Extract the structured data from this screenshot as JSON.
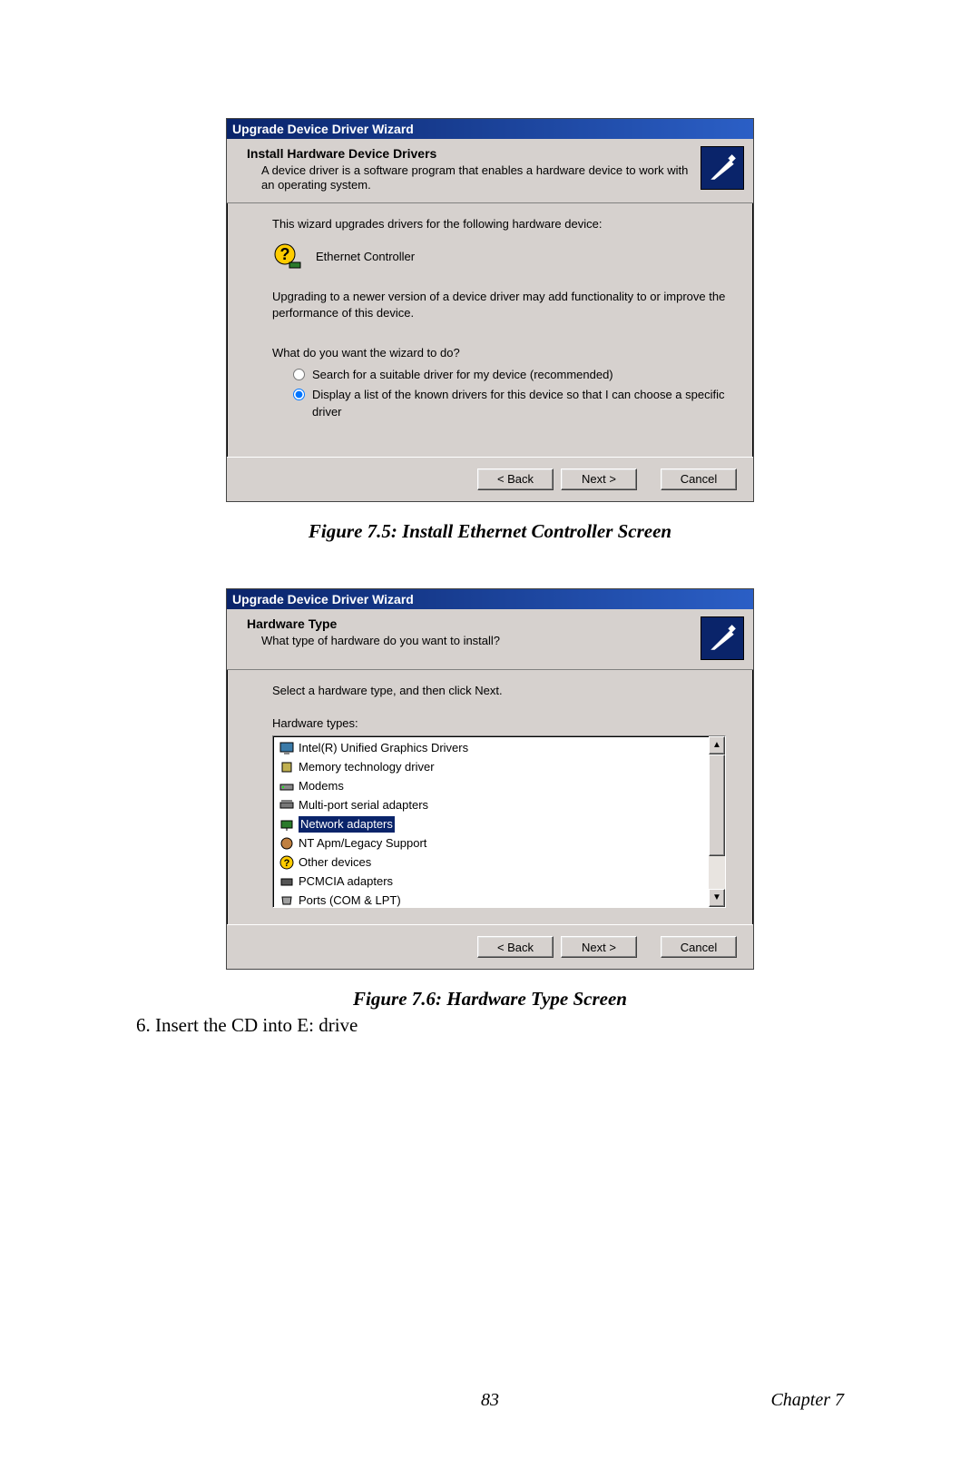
{
  "dialog1": {
    "title": "Upgrade Device Driver Wizard",
    "header_title": "Install Hardware Device Drivers",
    "header_sub": "A device driver is a software program that enables a hardware device to work with an operating system.",
    "intro": "This wizard upgrades drivers for the following hardware device:",
    "device": "Ethernet Controller",
    "upgrade_text": "Upgrading to a newer version of a device driver may add functionality to or improve the performance of this device.",
    "prompt": "What do you want the wizard to do?",
    "opt1": "Search for a suitable driver for my device (recommended)",
    "opt2": "Display a list of the known drivers for this device so that I can choose a specific driver",
    "back": "< Back",
    "next": "Next >",
    "cancel": "Cancel"
  },
  "caption1": "Figure 7.5: Install Ethernet Controller Screen",
  "dialog2": {
    "title": "Upgrade Device Driver Wizard",
    "header_title": "Hardware Type",
    "header_sub": "What type of hardware do you want to install?",
    "instruction": "Select a hardware type, and then click Next.",
    "listlabel": "Hardware types:",
    "items": [
      {
        "label": "Intel(R) Unified Graphics Drivers",
        "icon": "monitor",
        "selected": false
      },
      {
        "label": "Memory technology driver",
        "icon": "chip",
        "selected": false
      },
      {
        "label": "Modems",
        "icon": "modem",
        "selected": false
      },
      {
        "label": "Multi-port serial adapters",
        "icon": "serial",
        "selected": false
      },
      {
        "label": "Network adapters",
        "icon": "network",
        "selected": true
      },
      {
        "label": "NT Apm/Legacy Support",
        "icon": "legacy",
        "selected": false
      },
      {
        "label": "Other devices",
        "icon": "question",
        "selected": false
      },
      {
        "label": "PCMCIA adapters",
        "icon": "pcmcia",
        "selected": false
      },
      {
        "label": "Ports (COM & LPT)",
        "icon": "port",
        "selected": false
      }
    ],
    "back": "< Back",
    "next": "Next >",
    "cancel": "Cancel"
  },
  "caption2": "Figure 7.6: Hardware Type Screen",
  "step6": "6.  Insert the CD into E: drive",
  "page_number": "83",
  "chapter": "Chapter 7"
}
